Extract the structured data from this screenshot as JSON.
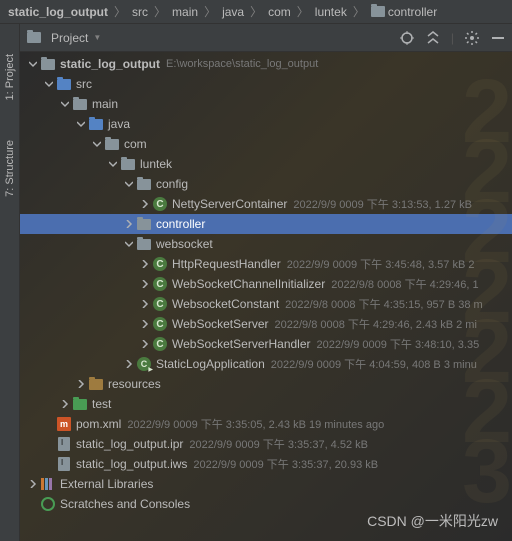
{
  "breadcrumb": [
    {
      "label": "static_log_output",
      "bold": true
    },
    {
      "label": "src"
    },
    {
      "label": "main"
    },
    {
      "label": "java"
    },
    {
      "label": "com"
    },
    {
      "label": "luntek"
    },
    {
      "label": "controller",
      "icon": "folder"
    }
  ],
  "rail": {
    "project": "1: Project",
    "structure": "7: Structure"
  },
  "toolbar": {
    "title": "Project",
    "dropdown": "▼"
  },
  "tree": [
    {
      "d": 0,
      "arrow": "down",
      "icon": "folder",
      "label": "static_log_output",
      "meta": "E:\\workspace\\static_log_output",
      "name": "project-root",
      "bold": true
    },
    {
      "d": 1,
      "arrow": "down",
      "icon": "folder-src",
      "label": "src",
      "name": "folder-src"
    },
    {
      "d": 2,
      "arrow": "down",
      "icon": "folder",
      "label": "main",
      "name": "folder-main"
    },
    {
      "d": 3,
      "arrow": "down",
      "icon": "folder-src",
      "label": "java",
      "name": "folder-java"
    },
    {
      "d": 4,
      "arrow": "down",
      "icon": "folder",
      "label": "com",
      "name": "folder-com"
    },
    {
      "d": 5,
      "arrow": "down",
      "icon": "folder",
      "label": "luntek",
      "name": "folder-luntek"
    },
    {
      "d": 6,
      "arrow": "down",
      "icon": "folder",
      "label": "config",
      "name": "folder-config"
    },
    {
      "d": 7,
      "arrow": "right",
      "icon": "class",
      "label": "NettyServerContainer",
      "meta": "2022/9/9 0009 下午 3:13:53, 1.27 kB",
      "name": "class-netty-server-container"
    },
    {
      "d": 6,
      "arrow": "right",
      "icon": "folder",
      "label": "controller",
      "name": "folder-controller",
      "selected": true
    },
    {
      "d": 6,
      "arrow": "down",
      "icon": "folder",
      "label": "websocket",
      "name": "folder-websocket"
    },
    {
      "d": 7,
      "arrow": "right",
      "icon": "class",
      "label": "HttpRequestHandler",
      "meta": "2022/9/9 0009 下午 3:45:48, 3.57 kB  2",
      "name": "class-http-request-handler"
    },
    {
      "d": 7,
      "arrow": "right",
      "icon": "class",
      "label": "WebSocketChannelInitializer",
      "meta": "2022/9/8 0008 下午 4:29:46, 1",
      "name": "class-websocket-channel-initializer"
    },
    {
      "d": 7,
      "arrow": "right",
      "icon": "class",
      "label": "WebsocketConstant",
      "meta": "2022/9/8 0008 下午 4:35:15, 957 B 38 m",
      "name": "class-websocket-constant"
    },
    {
      "d": 7,
      "arrow": "right",
      "icon": "class",
      "label": "WebSocketServer",
      "meta": "2022/9/8 0008 下午 4:29:46, 2.43 kB 2 mi",
      "name": "class-websocket-server"
    },
    {
      "d": 7,
      "arrow": "right",
      "icon": "class",
      "label": "WebSocketServerHandler",
      "meta": "2022/9/9 0009 下午 3:48:10, 3.35",
      "name": "class-websocket-server-handler"
    },
    {
      "d": 6,
      "arrow": "right",
      "icon": "app",
      "label": "StaticLogApplication",
      "meta": "2022/9/9 0009 下午 4:04:59, 408 B  3 minu",
      "name": "class-static-log-application"
    },
    {
      "d": 3,
      "arrow": "right",
      "icon": "folder-res",
      "label": "resources",
      "name": "folder-resources"
    },
    {
      "d": 2,
      "arrow": "right",
      "icon": "folder-test",
      "label": "test",
      "name": "folder-test"
    },
    {
      "d": 1,
      "arrow": "none",
      "icon": "maven",
      "label": "pom.xml",
      "meta": "2022/9/9 0009 下午 3:35:05, 2.43 kB 19 minutes ago",
      "name": "file-pom-xml"
    },
    {
      "d": 1,
      "arrow": "none",
      "icon": "ipr",
      "label": "static_log_output.ipr",
      "meta": "2022/9/9 0009 下午 3:35:37, 4.52 kB",
      "name": "file-ipr"
    },
    {
      "d": 1,
      "arrow": "none",
      "icon": "ipr",
      "label": "static_log_output.iws",
      "meta": "2022/9/9 0009 下午 3:35:37, 20.93 kB",
      "name": "file-iws"
    },
    {
      "d": 0,
      "arrow": "right",
      "icon": "lib",
      "label": "External Libraries",
      "name": "external-libraries"
    },
    {
      "d": 0,
      "arrow": "none",
      "icon": "scratch",
      "label": "Scratches and Consoles",
      "name": "scratches-consoles"
    }
  ],
  "watermark": "CSDN @一米阳光zw"
}
